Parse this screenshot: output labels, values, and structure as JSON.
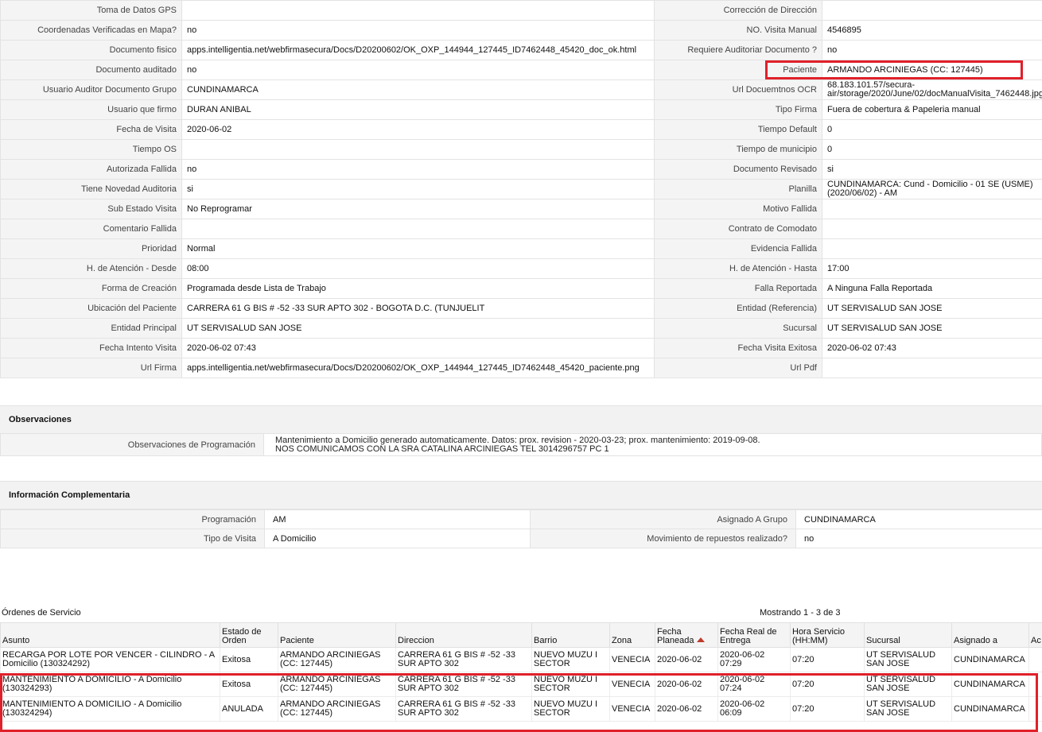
{
  "details": [
    {
      "l1": "Toma de Datos GPS",
      "v1": "",
      "l2": "Corrección de Dirección",
      "v2": ""
    },
    {
      "l1": "Coordenadas Verificadas en Mapa?",
      "v1": "no",
      "l2": "NO. Visita Manual",
      "v2": "4546895"
    },
    {
      "l1": "Documento fisico",
      "v1": "apps.intelligentia.net/webfirmasecura/Docs/D20200602/OK_OXP_144944_127445_ID7462448_45420_doc_ok.html",
      "l2": "Requiere Auditoriar Documento ?",
      "v2": "no"
    },
    {
      "l1": "Documento auditado",
      "v1": "no",
      "l2": "Paciente",
      "v2": "ARMANDO ARCINIEGAS (CC: 127445)"
    },
    {
      "l1": "Usuario Auditor Documento Grupo",
      "v1": "CUNDINAMARCA",
      "l2": "Url Docuemtnos OCR",
      "v2": "68.183.101.57/secura-air/storage/2020/June/02/docManualVisita_7462448.jpg"
    },
    {
      "l1": "Usuario que firmo",
      "v1": "DURAN ANIBAL",
      "l2": "Tipo Firma",
      "v2": "Fuera de cobertura & Papeleria manual"
    },
    {
      "l1": "Fecha de Visita",
      "v1": "2020-06-02",
      "l2": "Tiempo Default",
      "v2": "0"
    },
    {
      "l1": "Tiempo OS",
      "v1": "",
      "l2": "Tiempo de municipio",
      "v2": "0"
    },
    {
      "l1": "Autorizada Fallida",
      "v1": "no",
      "l2": "Documento Revisado",
      "v2": "si"
    },
    {
      "l1": "Tiene Novedad Auditoria",
      "v1": "si",
      "l2": "Planilla",
      "v2": "CUNDINAMARCA: Cund - Domicilio - 01 SE (USME) (2020/06/02) - AM"
    },
    {
      "l1": "Sub Estado Visita",
      "v1": "No Reprogramar",
      "l2": "Motivo Fallida",
      "v2": ""
    },
    {
      "l1": "Comentario Fallida",
      "v1": "",
      "l2": "Contrato de Comodato",
      "v2": ""
    },
    {
      "l1": "Prioridad",
      "v1": "Normal",
      "l2": "Evidencia Fallida",
      "v2": ""
    },
    {
      "l1": "H. de Atención - Desde",
      "v1": "08:00",
      "l2": "H. de Atención - Hasta",
      "v2": "17:00"
    },
    {
      "l1": "Forma de Creación",
      "v1": "Programada desde Lista de Trabajo",
      "l2": "Falla Reportada",
      "v2": "A Ninguna Falla Reportada"
    },
    {
      "l1": "Ubicación del Paciente",
      "v1": "CARRERA 61 G BIS # -52 -33 SUR APTO 302 - BOGOTA D.C. (TUNJUELIT",
      "l2": "Entidad (Referencia)",
      "v2": "UT SERVISALUD SAN JOSE"
    },
    {
      "l1": "Entidad Principal",
      "v1": "UT SERVISALUD SAN JOSE",
      "l2": "Sucursal",
      "v2": "UT SERVISALUD SAN JOSE"
    },
    {
      "l1": "Fecha Intento Visita",
      "v1": "2020-06-02 07:43",
      "l2": "Fecha Visita Exitosa",
      "v2": "2020-06-02 07:43"
    },
    {
      "l1": "Url Firma",
      "v1": "apps.intelligentia.net/webfirmasecura/Docs/D20200602/OK_OXP_144944_127445_ID7462448_45420_paciente.png",
      "l2": "Url Pdf",
      "v2": ""
    }
  ],
  "observaciones": {
    "title": "Observaciones",
    "label": "Observaciones de Programación",
    "line1": "Mantenimiento a Domicilio generado automaticamente. Datos: prox. revision - 2020-03-23; prox. mantenimiento: 2019-09-08.",
    "line2": "NOS COMUNICAMOS CON LA SRA CATALINA ARCINIEGAS TEL 3014296757 PC 1"
  },
  "complementaria": {
    "title": "Información Complementaria",
    "rows": [
      {
        "l1": "Programación",
        "v1": "AM",
        "l2": "Asignado A Grupo",
        "v2": "CUNDINAMARCA"
      },
      {
        "l1": "Tipo de Visita",
        "v1": "A Domicilio",
        "l2": "Movimiento de repuestos realizado?",
        "v2": "no"
      }
    ]
  },
  "orders": {
    "title": "Órdenes de Servicio",
    "showing": "Mostrando 1 - 3 de 3",
    "columns": [
      "Asunto",
      "Estado de Orden",
      "Paciente",
      "Direccion",
      "Barrio",
      "Zona",
      "Fecha Planeada",
      "Fecha Real de Entrega",
      "Hora Servicio (HH:MM)",
      "Sucursal",
      "Asignado a",
      "Ac"
    ],
    "rows": [
      [
        "RECARGA POR LOTE POR VENCER - CILINDRO - A Domicilio (130324292)",
        "Exitosa",
        "ARMANDO ARCINIEGAS (CC: 127445)",
        "CARRERA 61 G BIS # -52 -33 SUR APTO 302",
        "NUEVO MUZU I SECTOR",
        "VENECIA",
        "2020-06-02",
        "2020-06-02 07:29",
        "07:20",
        "UT SERVISALUD SAN JOSE",
        "CUNDINAMARCA",
        ""
      ],
      [
        "MANTENIMIENTO A DOMICILIO - A Domicilio (130324293)",
        "Exitosa",
        "ARMANDO ARCINIEGAS (CC: 127445)",
        "CARRERA 61 G BIS # -52 -33 SUR APTO 302",
        "NUEVO MUZU I SECTOR",
        "VENECIA",
        "2020-06-02",
        "2020-06-02 07:24",
        "07:20",
        "UT SERVISALUD SAN JOSE",
        "CUNDINAMARCA",
        ""
      ],
      [
        "MANTENIMIENTO A DOMICILIO - A Domicilio (130324294)",
        "ANULADA",
        "ARMANDO ARCINIEGAS (CC: 127445)",
        "CARRERA 61 G BIS # -52 -33 SUR APTO 302",
        "NUEVO MUZU I SECTOR",
        "VENECIA",
        "2020-06-02",
        "2020-06-02 06:09",
        "07:20",
        "UT SERVISALUD SAN JOSE",
        "CUNDINAMARCA",
        ""
      ]
    ]
  },
  "highlight_color": "#e0202a"
}
